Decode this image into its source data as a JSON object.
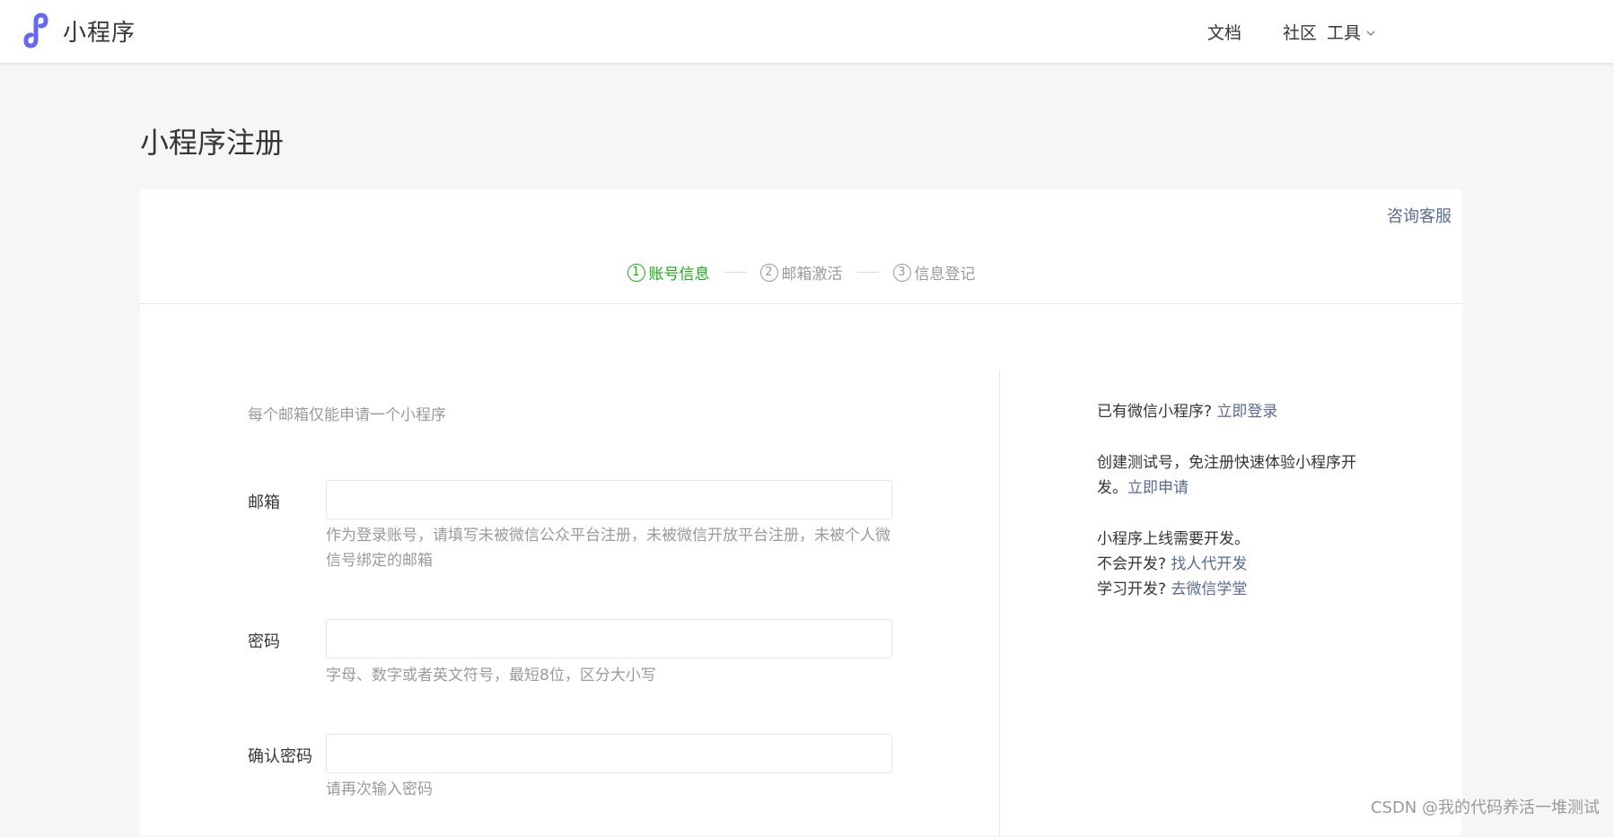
{
  "header": {
    "logo_text": "小程序",
    "nav": {
      "docs": "文档",
      "community": "社区",
      "tools": "工具"
    }
  },
  "page": {
    "title": "小程序注册"
  },
  "panel": {
    "consult_link": "咨询客服",
    "steps": [
      {
        "num": "1",
        "label": "账号信息"
      },
      {
        "num": "2",
        "label": "邮箱激活"
      },
      {
        "num": "3",
        "label": "信息登记"
      }
    ],
    "tip": "每个邮箱仅能申请一个小程序",
    "form": {
      "email_label": "邮箱",
      "email_hint": "作为登录账号，请填写未被微信公众平台注册，未被微信开放平台注册，未被个人微信号绑定的邮箱",
      "password_label": "密码",
      "password_hint": "字母、数字或者英文符号，最短8位，区分大小写",
      "confirm_label": "确认密码",
      "confirm_hint": "请再次输入密码"
    },
    "side": {
      "has_account": "已有微信小程序?",
      "login_link": "立即登录",
      "test_text": "创建测试号，免注册快速体验小程序开发。",
      "test_link": "立即申请",
      "dev_text": "小程序上线需要开发。",
      "no_dev": "不会开发?",
      "find_dev_link": "找人代开发",
      "learn_dev": "学习开发?",
      "academy_link": "去微信学堂"
    }
  },
  "watermark": "CSDN @我的代码养活一堆测试",
  "colors": {
    "accent_green": "#1aad19",
    "link_blue": "#576b95",
    "logo_purple": "#6467f0"
  }
}
